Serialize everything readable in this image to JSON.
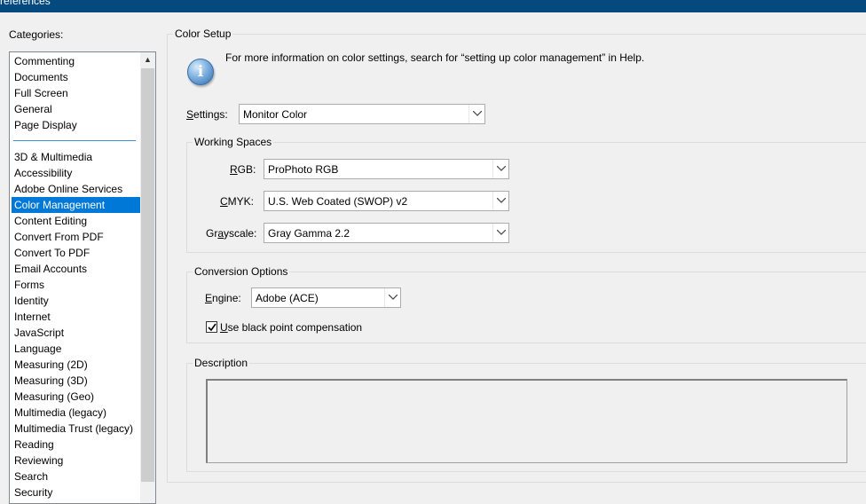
{
  "window": {
    "title": "references"
  },
  "categories": {
    "label": "Categories:",
    "items": [
      "Commenting",
      "Documents",
      "Full Screen",
      "General",
      "Page Display",
      "3D & Multimedia",
      "Accessibility",
      "Adobe Online Services",
      "Color Management",
      "Content Editing",
      "Convert From PDF",
      "Convert To PDF",
      "Email Accounts",
      "Forms",
      "Identity",
      "Internet",
      "JavaScript",
      "Language",
      "Measuring (2D)",
      "Measuring (3D)",
      "Measuring (Geo)",
      "Multimedia (legacy)",
      "Multimedia Trust (legacy)",
      "Reading",
      "Reviewing",
      "Search",
      "Security"
    ],
    "selected": "Color Management"
  },
  "color_setup": {
    "title": "Color Setup",
    "info_text": "For more information on color settings, search for “setting up color management” in Help.",
    "settings_label": "Settings:",
    "settings_value": "Monitor Color"
  },
  "working_spaces": {
    "title": "Working Spaces",
    "rgb_label": "RGB:",
    "rgb_value": "ProPhoto RGB",
    "cmyk_label": "CMYK:",
    "cmyk_value": "U.S. Web Coated (SWOP) v2",
    "gray_label": "Grayscale:",
    "gray_value": "Gray Gamma 2.2"
  },
  "conversion": {
    "title": "Conversion Options",
    "engine_label": "Engine:",
    "engine_value": "Adobe (ACE)",
    "bpc_label": "Use black point compensation",
    "bpc_checked": true
  },
  "description": {
    "title": "Description"
  },
  "colors": {
    "selection": "#0078d7",
    "titlebar": "#044a7f"
  }
}
